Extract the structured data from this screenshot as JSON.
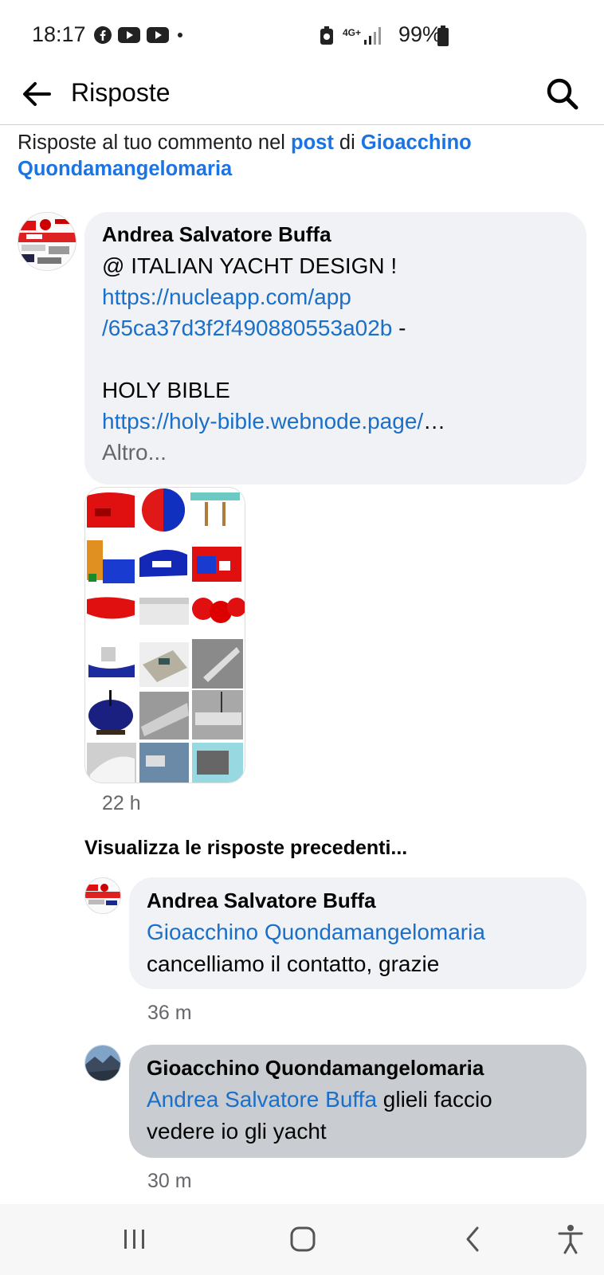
{
  "status": {
    "time": "18:17",
    "network": "4G+",
    "battery": "99%"
  },
  "header": {
    "title": "Risposte"
  },
  "context": {
    "prefix": "Risposte al tuo commento nel ",
    "post_link": "post",
    "middle": " di ",
    "author_link": "Gioacchino Quondamangelomaria"
  },
  "comment": {
    "author": "Andrea Salvatore Buffa",
    "line1": "@ ITALIAN YACHT DESIGN !",
    "link1a": "https://nucleapp.com/app",
    "link1b": "/65ca37d3f2f490880553a02b",
    "dash": " -",
    "line2": "HOLY BIBLE",
    "link2": "https://holy-bible.webnode.page/",
    "ellipsis": "…",
    "more": "Altro...",
    "time": "22 h"
  },
  "previous_replies": "Visualizza le risposte precedenti...",
  "replies": [
    {
      "author": "Andrea Salvatore Buffa",
      "mention": "Gioacchino Quondamangelomaria",
      "text": "cancelliamo il contatto, grazie",
      "time": "36 m"
    },
    {
      "author": "Gioacchino Quondamangelomaria",
      "mention": "Andrea Salvatore Buffa",
      "text_a": " glieli faccio",
      "text_b": "vedere io gli yacht",
      "time": "30 m"
    }
  ],
  "colors": {
    "link": "#1b74e4",
    "bubble": "#f0f2f5",
    "bubble_highlight": "#c9ccd1"
  },
  "icons": [
    "facebook-icon",
    "youtube-icon",
    "back-arrow-icon",
    "search-icon",
    "recents-icon",
    "home-icon",
    "nav-back-icon",
    "accessibility-icon"
  ]
}
